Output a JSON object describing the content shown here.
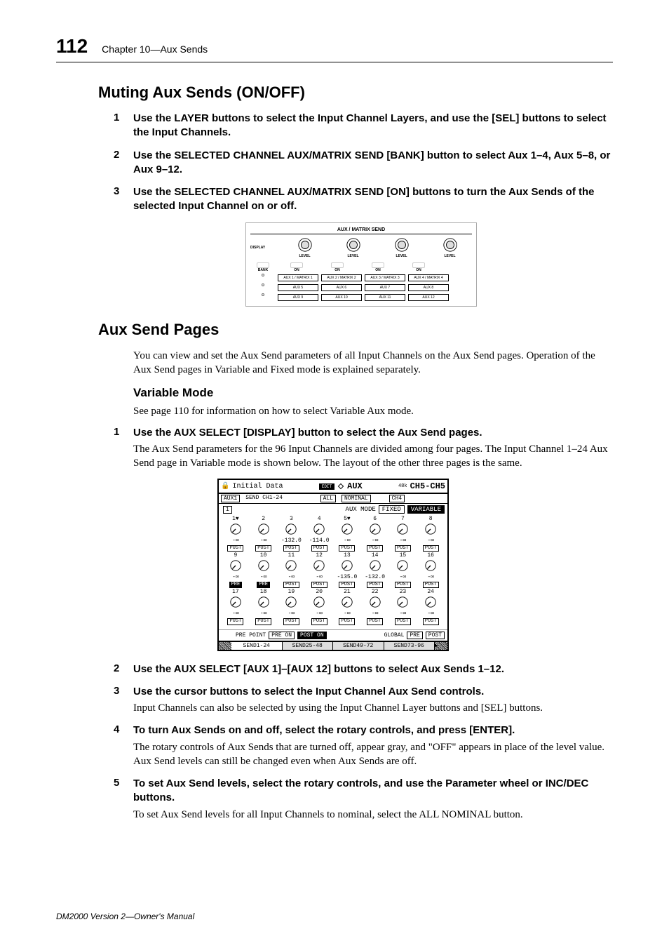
{
  "header": {
    "page_num": "112",
    "chapter": "Chapter 10—Aux Sends"
  },
  "section1": {
    "title": "Muting Aux Sends (ON/OFF)",
    "steps": [
      {
        "num": "1",
        "bold": "Use the LAYER buttons to select the Input Channel Layers, and use the [SEL] buttons to select the Input Channels."
      },
      {
        "num": "2",
        "bold": "Use the SELECTED CHANNEL AUX/MATRIX SEND [BANK] button to select Aux 1–4, Aux 5–8, or Aux 9–12."
      },
      {
        "num": "3",
        "bold": "Use the SELECTED CHANNEL AUX/MATRIX SEND [ON] buttons to turn the Aux Sends of the selected Input Channel on or off."
      }
    ]
  },
  "fig1": {
    "title": "AUX / MATRIX SEND",
    "display": "DISPLAY",
    "level": "LEVEL",
    "bank": "BANK",
    "on": "ON",
    "rows": [
      [
        "AUX 1 / MATRIX 1",
        "AUX 2 / MATRIX 2",
        "AUX 3 / MATRIX 3",
        "AUX 4 / MATRIX 4"
      ],
      [
        "AUX 5",
        "AUX 6",
        "AUX 7",
        "AUX 8"
      ],
      [
        "AUX 9",
        "AUX 10",
        "AUX 11",
        "AUX 12"
      ]
    ]
  },
  "section2": {
    "title": "Aux Send Pages",
    "intro": "You can view and set the Aux Send parameters of all Input Channels on the Aux Send pages. Operation of the Aux Send pages in Variable and Fixed mode is explained separately.",
    "subhead": "Variable Mode",
    "subintro": "See page 110 for information on how to select Variable Aux mode.",
    "steps": [
      {
        "num": "1",
        "bold": "Use the AUX SELECT [DISPLAY] button to select the Aux Send pages.",
        "desc": "The Aux Send parameters for the 96 Input Channels are divided among four pages. The Input Channel 1–24 Aux Send page in Variable mode is shown below. The layout of the other three pages is the same."
      },
      {
        "num": "2",
        "bold": "Use the AUX SELECT [AUX 1]–[AUX 12] buttons to select Aux Sends 1–12."
      },
      {
        "num": "3",
        "bold": "Use the cursor buttons to select the Input Channel Aux Send controls.",
        "desc": "Input Channels can also be selected by using the Input Channel Layer buttons and [SEL] buttons."
      },
      {
        "num": "4",
        "bold": "To turn Aux Sends on and off, select the rotary controls, and press [ENTER].",
        "desc": "The rotary controls of Aux Sends that are turned off, appear gray, and \"OFF\" appears in place of the level value. Aux Send levels can still be changed even when Aux Sends are off."
      },
      {
        "num": "5",
        "bold": "To set Aux Send levels, select the rotary controls, and use the Parameter wheel or INC/DEC buttons.",
        "desc": "To set Aux Send levels for all Input Channels to nominal, select the ALL NOMINAL button."
      }
    ]
  },
  "fig2": {
    "titlebar": {
      "left": "Initial Data",
      "edit_icon": "EDIT",
      "aux_label": "AUX",
      "rate": "48k ST",
      "ch": "CH5-CH5"
    },
    "bar2": {
      "aux1": "AUX1",
      "send": "SEND CH1-24",
      "all": "ALL",
      "nominal": "NOMINAL",
      "ch4": "CH4"
    },
    "mode": {
      "label": "AUX MODE",
      "fixed": "FIXED",
      "variable": "VARIABLE"
    },
    "knobs": [
      [
        {
          "n": "1",
          "v": "-∞",
          "p": "POST",
          "pair": true
        },
        {
          "n": "2",
          "v": "-∞",
          "p": "POST"
        },
        {
          "n": "3",
          "v": "-132.0",
          "p": "POST"
        },
        {
          "n": "4",
          "v": "-114.0",
          "p": "POST"
        },
        {
          "n": "5",
          "v": "-∞",
          "p": "POST",
          "pair": true
        },
        {
          "n": "6",
          "v": "-∞",
          "p": "POST"
        },
        {
          "n": "7",
          "v": "-∞",
          "p": "POST"
        },
        {
          "n": "8",
          "v": "-∞",
          "p": "POST"
        }
      ],
      [
        {
          "n": "9",
          "v": "-∞",
          "p": "PRE",
          "inv": true
        },
        {
          "n": "10",
          "v": "-∞",
          "p": "PRE",
          "inv": true
        },
        {
          "n": "11",
          "v": "-∞",
          "p": "POST"
        },
        {
          "n": "12",
          "v": "-∞",
          "p": "POST"
        },
        {
          "n": "13",
          "v": "-135.0",
          "p": "POST"
        },
        {
          "n": "14",
          "v": "-132.0",
          "p": "POST"
        },
        {
          "n": "15",
          "v": "-∞",
          "p": "POST"
        },
        {
          "n": "16",
          "v": "-∞",
          "p": "POST"
        }
      ],
      [
        {
          "n": "17",
          "v": "-∞",
          "p": "POST"
        },
        {
          "n": "18",
          "v": "-∞",
          "p": "POST"
        },
        {
          "n": "19",
          "v": "-∞",
          "p": "POST"
        },
        {
          "n": "20",
          "v": "-∞",
          "p": "POST"
        },
        {
          "n": "21",
          "v": "-∞",
          "p": "POST"
        },
        {
          "n": "22",
          "v": "-∞",
          "p": "POST"
        },
        {
          "n": "23",
          "v": "-∞",
          "p": "POST"
        },
        {
          "n": "24",
          "v": "-∞",
          "p": "POST"
        }
      ]
    ],
    "bottom": {
      "pre_point": "PRE POINT",
      "pre_on": "PRE ON",
      "post_on": "POST ON",
      "global": "GLOBAL",
      "pre": "PRE",
      "post": "POST"
    },
    "tabs": [
      "SEND1-24",
      "SEND25-48",
      "SEND49-72",
      "SEND73-96"
    ]
  },
  "footer": "DM2000 Version 2—Owner's Manual"
}
